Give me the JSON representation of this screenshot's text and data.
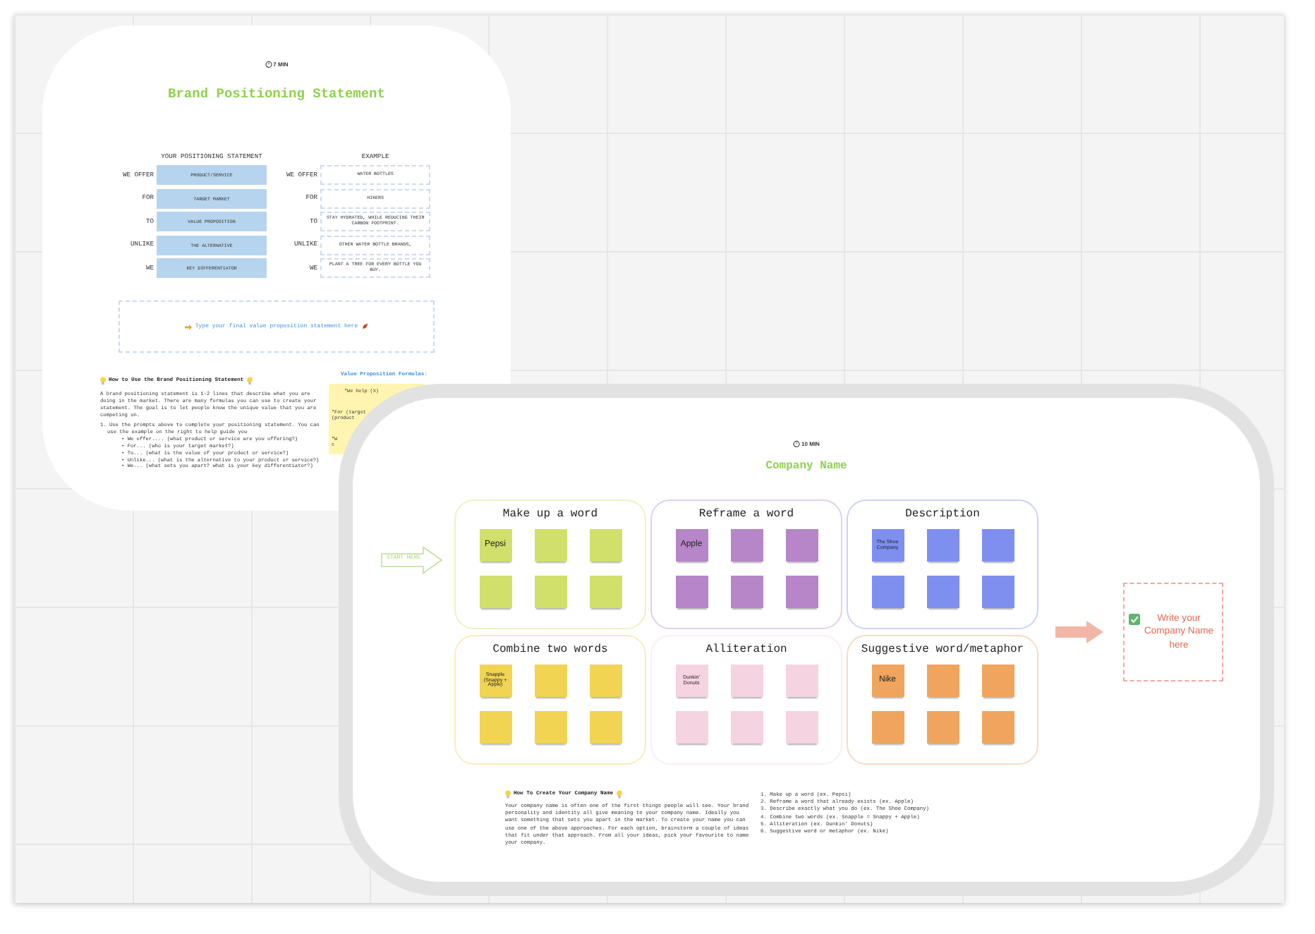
{
  "brand_card": {
    "timer": "7 MIN",
    "title": "Brand Positioning Statement",
    "statement_heading": "YOUR POSITIONING STATEMENT",
    "example_heading": "EXAMPLE",
    "statement_rows": [
      {
        "label": "WE OFFER",
        "value": "PRODUCT/SERVICE"
      },
      {
        "label": "FOR",
        "value": "TARGET MARKET"
      },
      {
        "label": "TO",
        "value": "VALUE PROPOSITION"
      },
      {
        "label": "UNLIKE",
        "value": "THE ALTERNATIVE"
      },
      {
        "label": "WE",
        "value": "KEY DIFFERENTIATOR"
      }
    ],
    "example_rows": [
      {
        "label": "WE OFFER",
        "value": "WATER BOTTLES"
      },
      {
        "label": "FOR",
        "value": "HIKERS"
      },
      {
        "label": "TO",
        "value": "STAY HYDRATED, WHILE REDUCING THEIR CARBON FOOTPRINT."
      },
      {
        "label": "UNLIKE",
        "value": "OTHER WATER BOTTLE BRANDS,"
      },
      {
        "label": "WE",
        "value": "PLANT A TREE FOR EVERY BOTTLE YOU BUY."
      }
    ],
    "final_statement": {
      "placeholder": "Type your final value proposition statement here"
    },
    "guide": {
      "heading": "How to Use the Brand Positioning Statement",
      "paragraph": "A brand positioning statement is 1-2 lines that describe what you are doing in the market. There are many formulas you can use to create your statement. The goal is to let people know the unique value that you are competing on.",
      "steps": [
        {
          "text": "1. Use the prompts above to complete your positioning statement. You can use the example on the right to help guide you",
          "items": [
            "• We offer.... (what product or service are you offering?)",
            "• For... (who is your target market?)",
            "• To... (what is the value of your product or service?)",
            "• Unlike... (what is the alternative to your product or service?)",
            "• We... (what sets you apart? what is your key differentiator?)"
          ]
        }
      ]
    },
    "formulas": {
      "heading": "Value Proposition Formulas:",
      "note_lines": [
        "\"We help (X)",
        "\"For (target",
        "(product",
        "\"W",
        "c"
      ]
    }
  },
  "company_card": {
    "timer": "10 MIN",
    "title": "Company Name",
    "start_label": "START HERE",
    "groups": [
      {
        "title": "Make up a word",
        "color": "#d1e06a",
        "example": "Pepsi"
      },
      {
        "title": "Reframe a word",
        "color": "#b686c9",
        "example": "Apple"
      },
      {
        "title": "Description",
        "color": "#7f8ff0",
        "example": "The Shoe Company"
      },
      {
        "title": "Combine two words",
        "color": "#f1d452",
        "example": "Snapple (Snappy + Apple)"
      },
      {
        "title": "Alliteration",
        "color": "#f6d3e1",
        "example": "Dunkin' Donuts"
      },
      {
        "title": "Suggestive word/metaphor",
        "color": "#f0a55e",
        "example": "Nike"
      }
    ],
    "answer_box": {
      "placeholder": "Write your Company Name here"
    },
    "guide": {
      "heading": "How To Create Your Company Name",
      "paragraph": "Your company name is often one of the first things people will see. Your brand personality and identity all give meaning to your company name. Ideally you want something that sets you apart in the market. To create your name you can use one of the above approaches. For each option, brainstorm a couple of ideas that fit under that approach. From all your ideas, pick your favourite to name your company.",
      "steps": [
        "1. Make up a word (ex. Pepsi)",
        "2. Reframe a word that already exists (ex. Apple)",
        "3. Describe exactly what you do (ex. The Shoe Company)",
        "4. Combine two words (ex. Snapple = Snappy + Apple)",
        "5. Alliteration (ex. Dunkin' Donuts)",
        "6. Suggestive word or metaphor (ex. Nike)"
      ]
    }
  }
}
